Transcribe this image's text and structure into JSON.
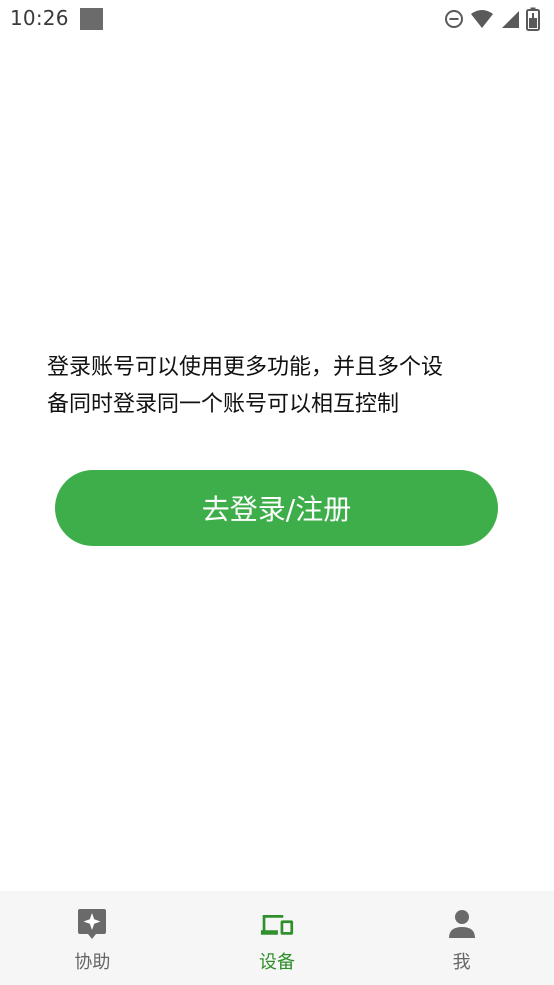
{
  "status_bar": {
    "time": "10:26",
    "icons": [
      "dnd-icon",
      "wifi-icon",
      "signal-icon",
      "battery-icon"
    ]
  },
  "main": {
    "message_lines": [
      "登录账号可以使用更多功能，并且多个设",
      "备同时登录同一个账号可以相互控制"
    ],
    "login_button_label": "去登录/注册"
  },
  "bottom_nav": {
    "items": [
      {
        "label": "协助",
        "icon": "sparkle-badge-icon",
        "active": false
      },
      {
        "label": "设备",
        "icon": "devices-icon",
        "active": true
      },
      {
        "label": "我",
        "icon": "person-icon",
        "active": false
      }
    ]
  },
  "colors": {
    "accent": "#3dae4a",
    "nav_active": "#2f8f2b",
    "nav_inactive": "#666666",
    "nav_background": "#f6f6f6"
  }
}
